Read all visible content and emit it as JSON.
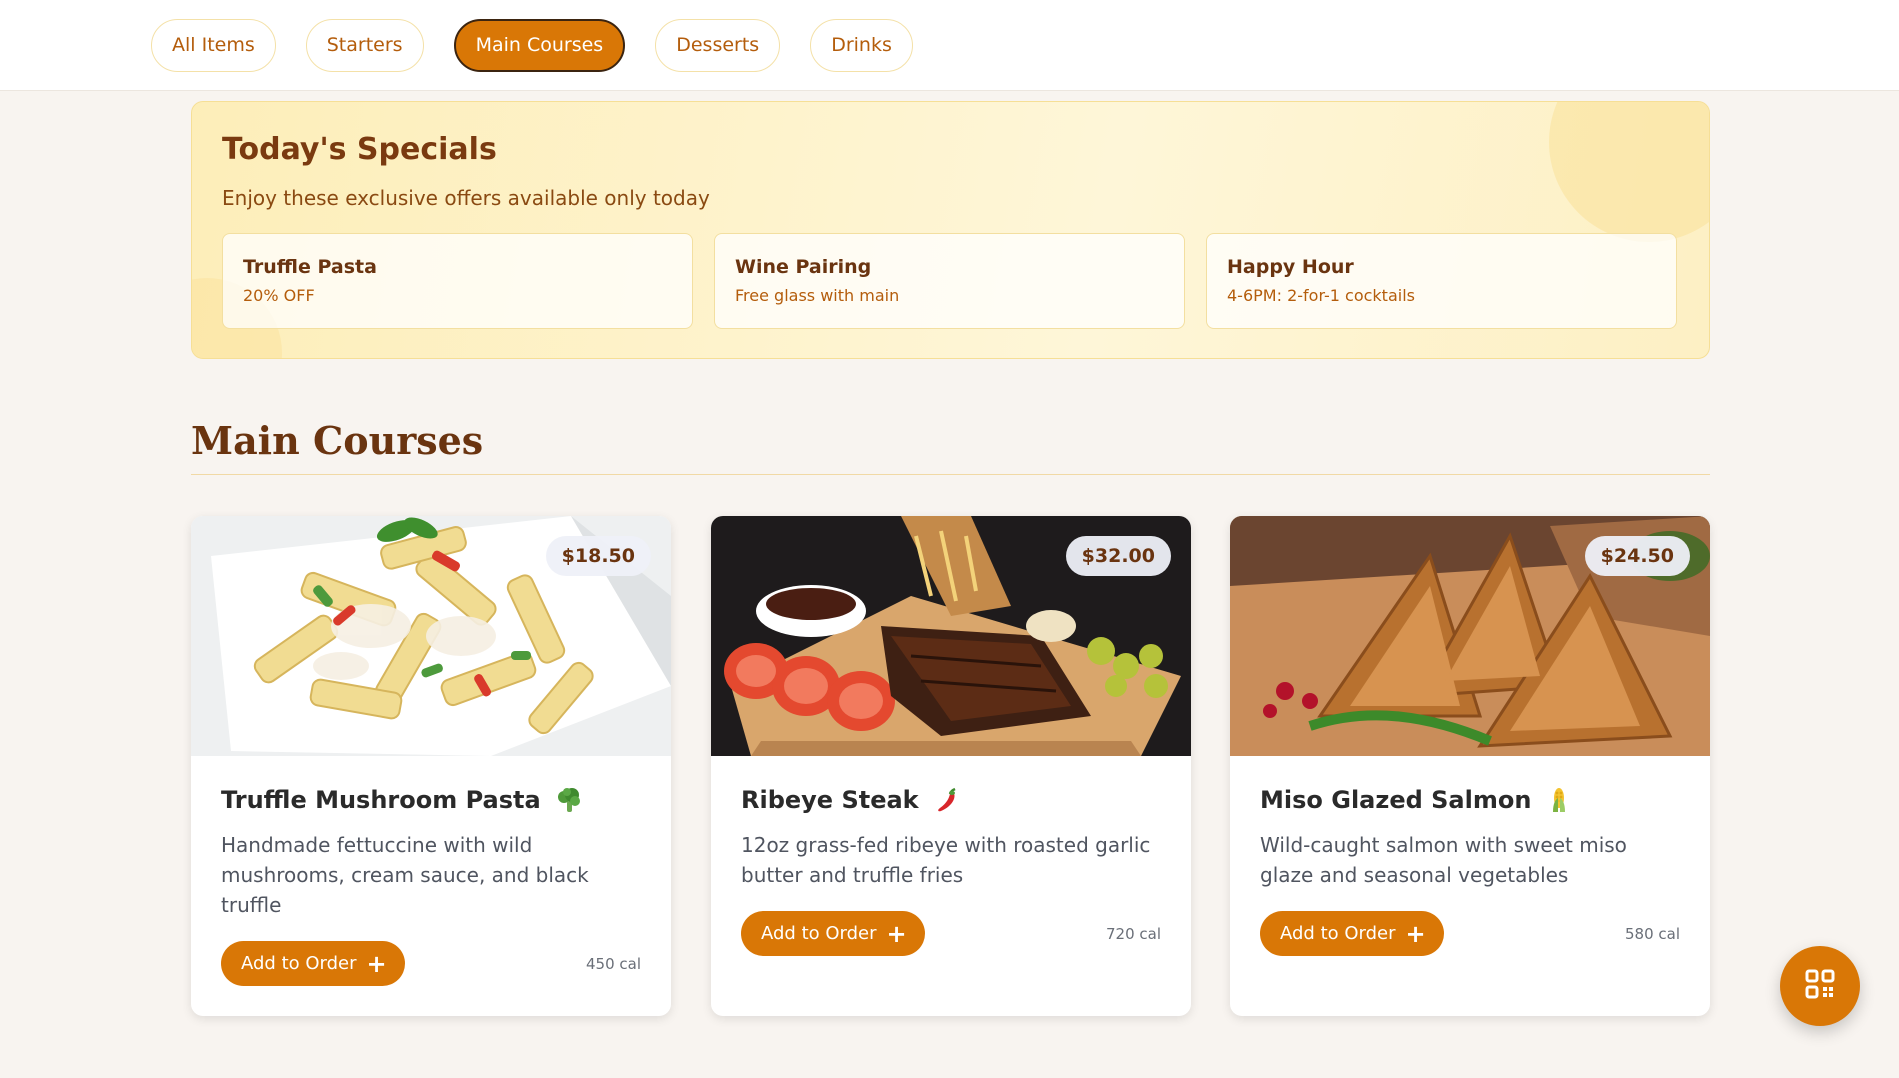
{
  "nav": {
    "categories": [
      {
        "label": "All Items"
      },
      {
        "label": "Starters"
      },
      {
        "label": "Main Courses",
        "active": true
      },
      {
        "label": "Desserts"
      },
      {
        "label": "Drinks"
      }
    ]
  },
  "specials": {
    "title": "Today's Specials",
    "subtitle": "Enjoy these exclusive offers available only today",
    "offers": [
      {
        "title": "Truffle Pasta",
        "detail": "20% OFF"
      },
      {
        "title": "Wine Pairing",
        "detail": "Free glass with main"
      },
      {
        "title": "Happy Hour",
        "detail": "4-6PM: 2-for-1 cocktails"
      }
    ]
  },
  "section": {
    "title": "Main Courses"
  },
  "dishes": [
    {
      "name": "Truffle Mushroom Pasta",
      "icon": "broccoli-icon",
      "price": "$18.50",
      "description": "Handmade fettuccine with wild mushrooms, cream sauce, and black truffle",
      "add_label": "Add to Order",
      "calories": "450 cal"
    },
    {
      "name": "Ribeye Steak",
      "icon": "chili-pepper-icon",
      "price": "$32.00",
      "description": "12oz grass-fed ribeye with roasted garlic butter and truffle fries",
      "add_label": "Add to Order",
      "calories": "720 cal"
    },
    {
      "name": "Miso Glazed Salmon",
      "icon": "corn-icon",
      "price": "$24.50",
      "description": "Wild-caught salmon with sweet miso glaze and seasonal vegetables",
      "add_label": "Add to Order",
      "calories": "580 cal"
    }
  ],
  "fab": {
    "icon": "qr-code-icon"
  },
  "colors": {
    "accent": "#d97706",
    "heading": "#6a3410",
    "background": "#f8f4f0"
  }
}
